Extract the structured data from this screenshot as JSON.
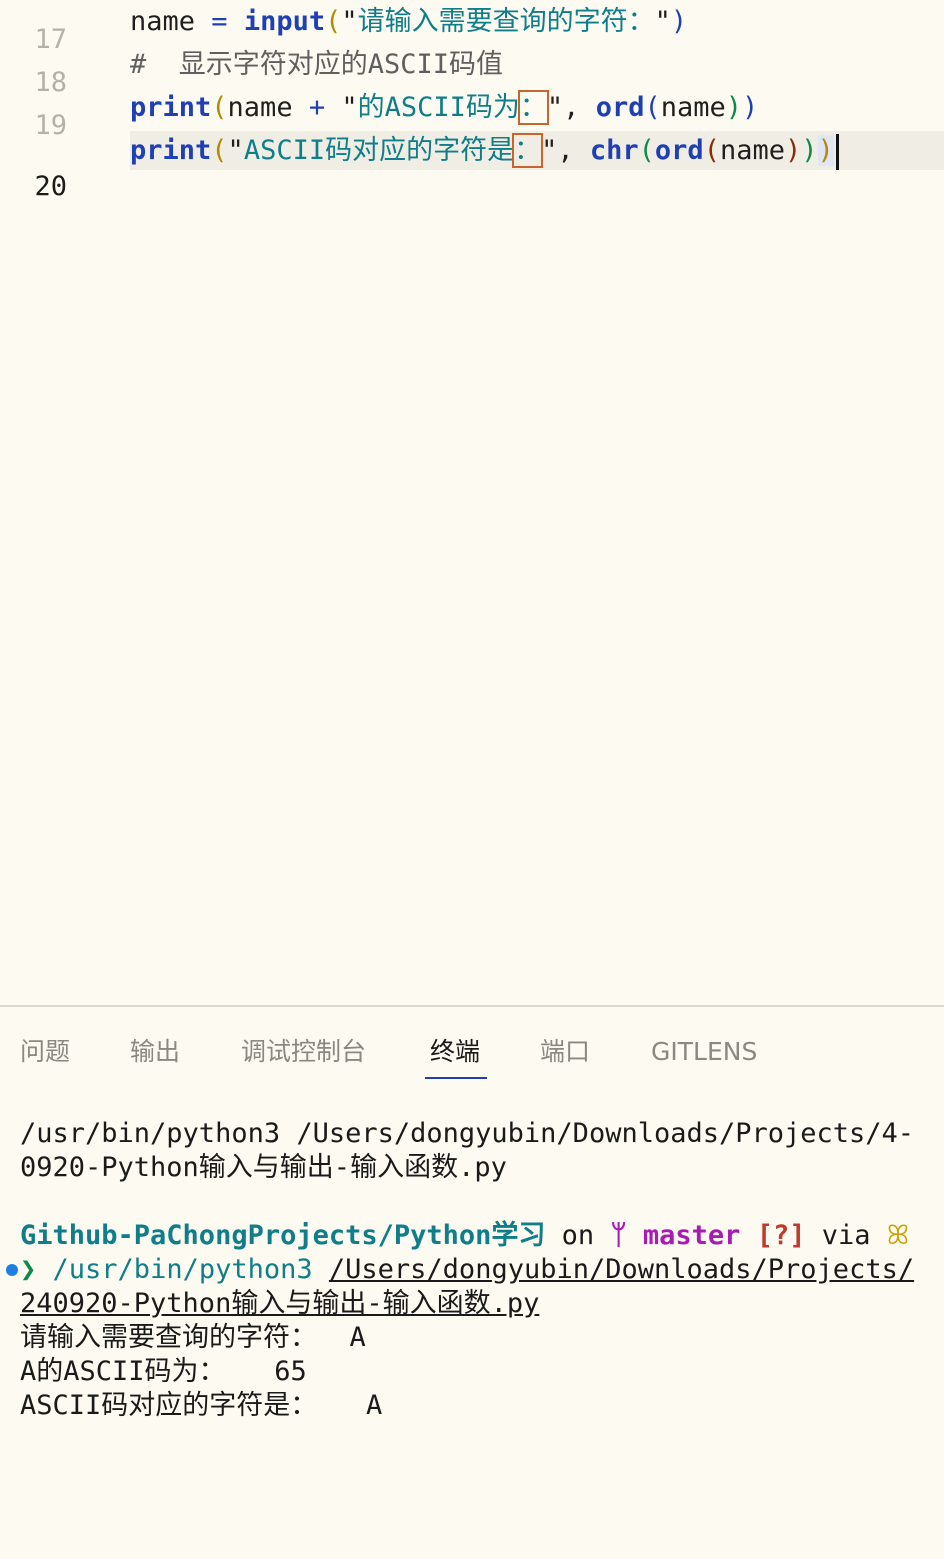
{
  "editor": {
    "lines": [
      {
        "num": "17",
        "parts": [
          "name",
          " = ",
          "input",
          "(",
          "\"",
          "请输入需要查询的字符：",
          "\"",
          ")"
        ]
      },
      {
        "num": "18",
        "comment": "#  显示字符对应的ASCII码值"
      },
      {
        "num": "19",
        "parts": [
          "print",
          "(",
          "name",
          " + ",
          "\"",
          "的ASCII码为",
          "：",
          "\"",
          ", ",
          "ord",
          "(",
          "name",
          ")",
          ")"
        ]
      },
      {
        "num": "20",
        "parts": [
          "print",
          "(",
          "\"",
          "ASCII码对应的字符是",
          "：",
          "\"",
          ", ",
          "chr",
          "(",
          "ord",
          "(",
          "name",
          ")",
          ")",
          ")"
        ]
      }
    ]
  },
  "panel": {
    "tabs": [
      "问题",
      "输出",
      "调试控制台",
      "终端",
      "端口",
      "GITLENS"
    ],
    "active_tab": "终端"
  },
  "terminal": {
    "cmd1_line1": "/usr/bin/python3 /Users/dongyubin/Downloads/Projects/4-",
    "cmd1_line2": "0920-Python输入与输出-输入函数.py",
    "repo": "Github-PaChongProjects/Python学习",
    "on": " on ",
    "branch_icon": "ᛘ",
    "branch": "master",
    "status": "[?]",
    "via": " via ",
    "prompt_symbol": "❯",
    "python_path": "/usr/bin/python3",
    "script_path_1": "/Users/dongyubin/Downloads/Projects/",
    "script_path_2": "240920-Python输入与输出-输入函数.py",
    "out1": "请输入需要查询的字符：  A",
    "out2": "A的ASCII码为：   65",
    "out3": "ASCII码对应的字符是：   A"
  }
}
